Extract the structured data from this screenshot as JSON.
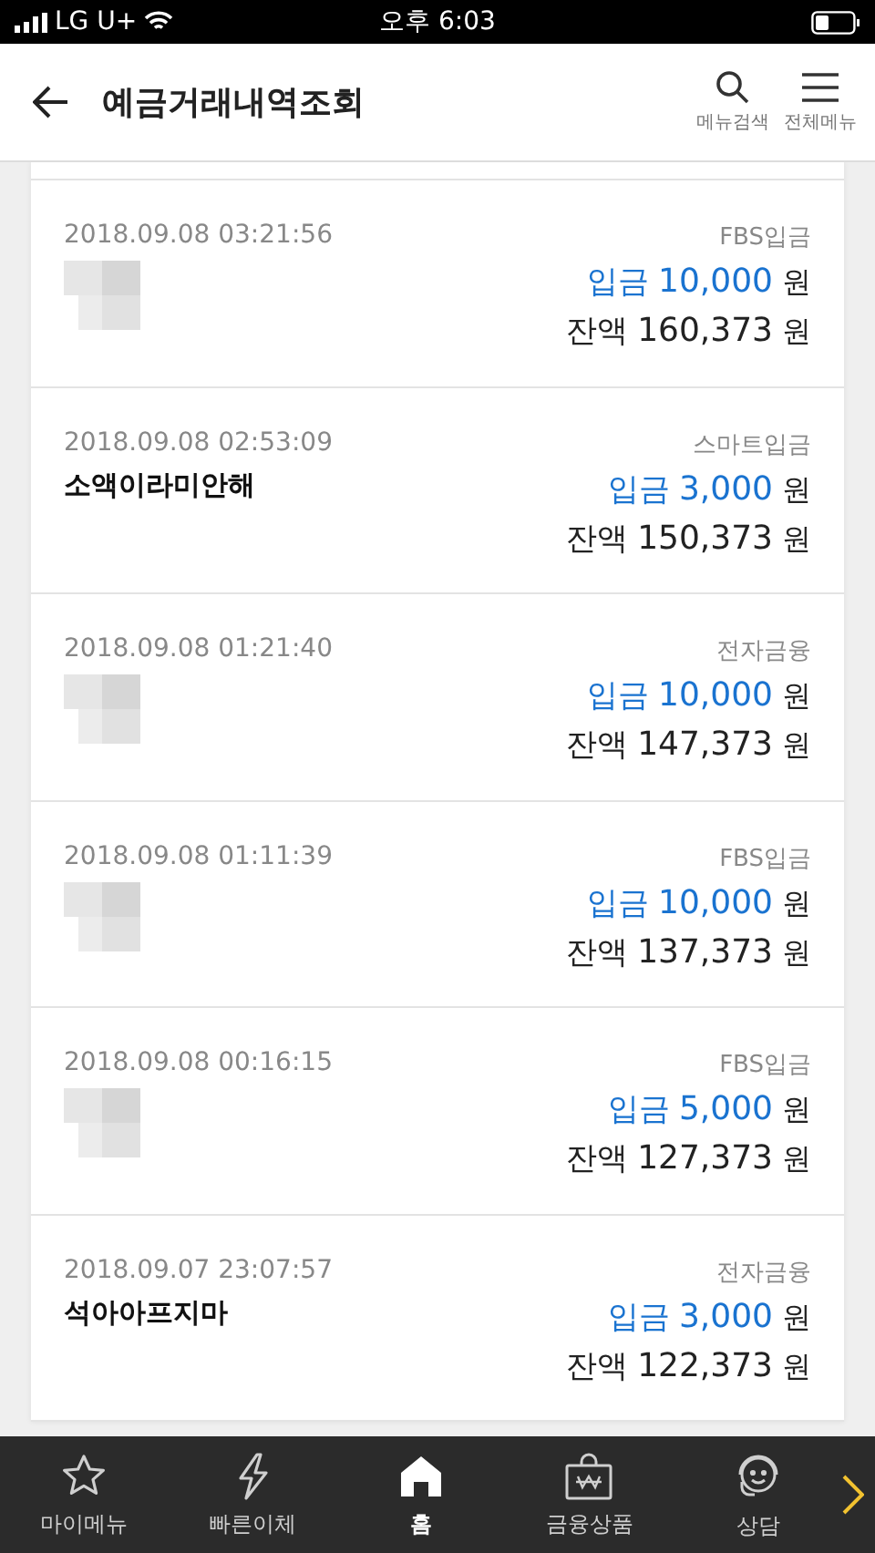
{
  "status_bar": {
    "carrier": "LG U+",
    "time": "오후 6:03"
  },
  "header": {
    "title": "예금거래내역조회",
    "search_label": "메뉴검색",
    "menu_label": "전체메뉴"
  },
  "transactions": [
    {
      "datetime": "2018.09.08 03:21:56",
      "redacted": true,
      "type": "FBS입금",
      "amount_label": "입금",
      "amount": "10,000",
      "amount_unit": "원",
      "balance_label": "잔액",
      "balance": "160,373",
      "balance_unit": "원"
    },
    {
      "datetime": "2018.09.08 02:53:09",
      "redacted": false,
      "memo": "소액이라미안해",
      "type": "스마트입금",
      "amount_label": "입금",
      "amount": "3,000",
      "amount_unit": "원",
      "balance_label": "잔액",
      "balance": "150,373",
      "balance_unit": "원"
    },
    {
      "datetime": "2018.09.08 01:21:40",
      "redacted": true,
      "type": "전자금융",
      "amount_label": "입금",
      "amount": "10,000",
      "amount_unit": "원",
      "balance_label": "잔액",
      "balance": "147,373",
      "balance_unit": "원"
    },
    {
      "datetime": "2018.09.08 01:11:39",
      "redacted": true,
      "type": "FBS입금",
      "amount_label": "입금",
      "amount": "10,000",
      "amount_unit": "원",
      "balance_label": "잔액",
      "balance": "137,373",
      "balance_unit": "원"
    },
    {
      "datetime": "2018.09.08 00:16:15",
      "redacted": true,
      "type": "FBS입금",
      "amount_label": "입금",
      "amount": "5,000",
      "amount_unit": "원",
      "balance_label": "잔액",
      "balance": "127,373",
      "balance_unit": "원"
    },
    {
      "datetime": "2018.09.07 23:07:57",
      "redacted": false,
      "memo": "석아아프지마",
      "type": "전자금융",
      "amount_label": "입금",
      "amount": "3,000",
      "amount_unit": "원",
      "balance_label": "잔액",
      "balance": "122,373",
      "balance_unit": "원"
    }
  ],
  "bottom_nav": [
    {
      "kind": "star",
      "label": "마이메뉴",
      "selected": false
    },
    {
      "kind": "bolt",
      "label": "빠른이체",
      "selected": false
    },
    {
      "kind": "home",
      "label": "홈",
      "selected": true
    },
    {
      "kind": "bag",
      "label": "금융상품",
      "selected": false
    },
    {
      "kind": "chat",
      "label": "상담",
      "selected": false
    }
  ]
}
